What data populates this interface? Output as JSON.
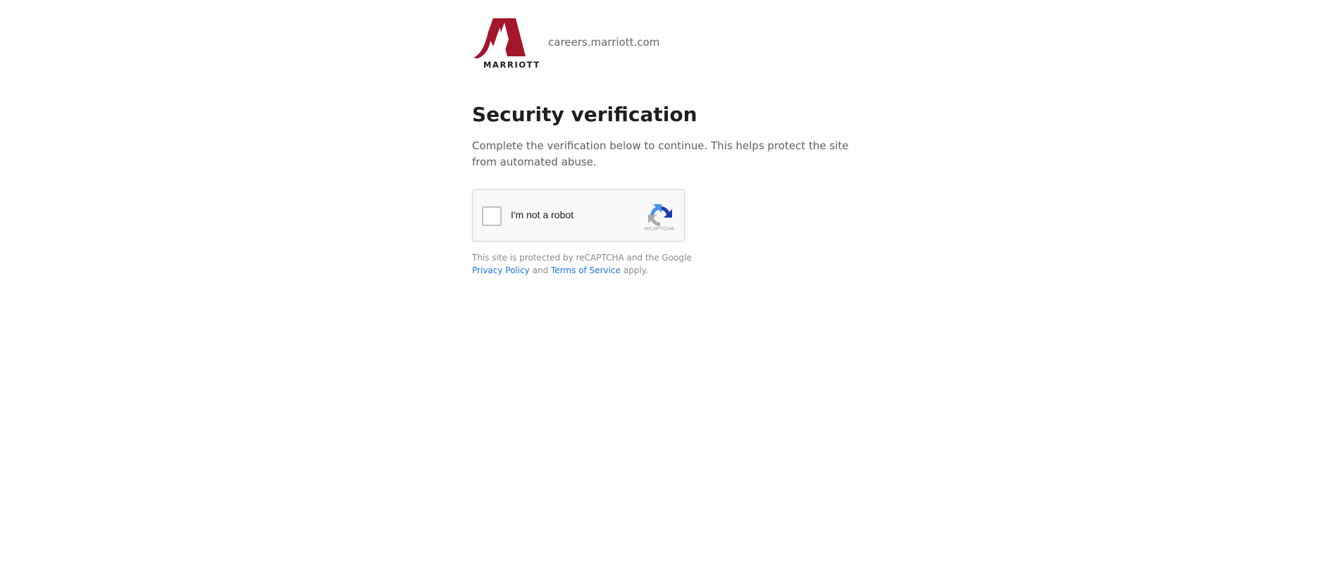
{
  "brand": {
    "name": "MARRIOTT",
    "domain": "careers.marriott.com",
    "color": "#a3162b"
  },
  "content": {
    "title": "Security verification",
    "description": "Complete the verification below to continue. This helps protect the site from automated abuse."
  },
  "captcha": {
    "checkbox_label": "I'm not a robot",
    "badge_text": "reCAPTCHA",
    "icon": "recaptcha-icon"
  },
  "legal": {
    "line1": "This site is protected by reCAPTCHA and the Google",
    "privacy_link": "Privacy Policy",
    "and": "and",
    "terms_link": "Terms of Service",
    "apply": "apply."
  },
  "colors": {
    "link": "#1a73e8",
    "title": "#1f1f1f"
  }
}
